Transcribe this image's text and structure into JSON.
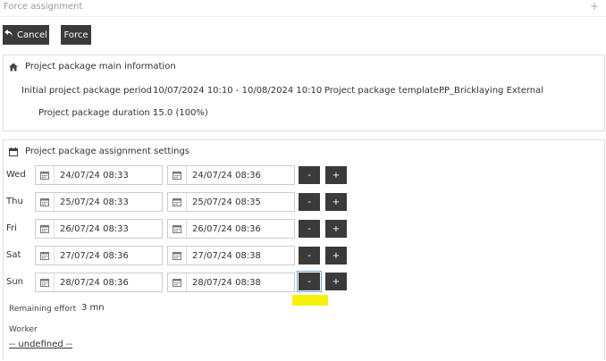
{
  "window": {
    "title": "Force assignment",
    "expand_glyph": "+"
  },
  "toolbar": {
    "cancel_label": "Cancel",
    "force_label": "Force",
    "cancel_icon": "undo-arrow-icon"
  },
  "main_info": {
    "heading": "Project package main information",
    "heading_icon": "home-icon",
    "period_label": "Initial project package period :",
    "period_value": "10/07/2024 10:10 - 10/08/2024 10:10",
    "template_label": "Project package template :",
    "template_value": "PP_Bricklaying External",
    "duration_label": "Project package duration :",
    "duration_value": "15.0 (100%)"
  },
  "assignment": {
    "heading": "Project package assignment settings",
    "heading_icon": "calendar-icon",
    "rows": [
      {
        "day": "Wed",
        "start": "24/07/24 08:33",
        "end": "24/07/24 08:36"
      },
      {
        "day": "Thu",
        "start": "25/07/24 08:33",
        "end": "25/07/24 08:35"
      },
      {
        "day": "Fri",
        "start": "26/07/24 08:33",
        "end": "26/07/24 08:36"
      },
      {
        "day": "Sat",
        "start": "27/07/24 08:36",
        "end": "27/07/24 08:38"
      },
      {
        "day": "Sun",
        "start": "28/07/24 08:36",
        "end": "28/07/24 08:38"
      }
    ],
    "minus_label": "-",
    "plus_label": "+",
    "remaining_label": "Remaining effort",
    "remaining_value": "3 mn",
    "worker_label": "Worker",
    "worker_value": "-- undefined --"
  },
  "colors": {
    "button_dark": "#3a3a3a",
    "highlight": "#f7f20c",
    "focus_outline": "#6fa8dc"
  }
}
